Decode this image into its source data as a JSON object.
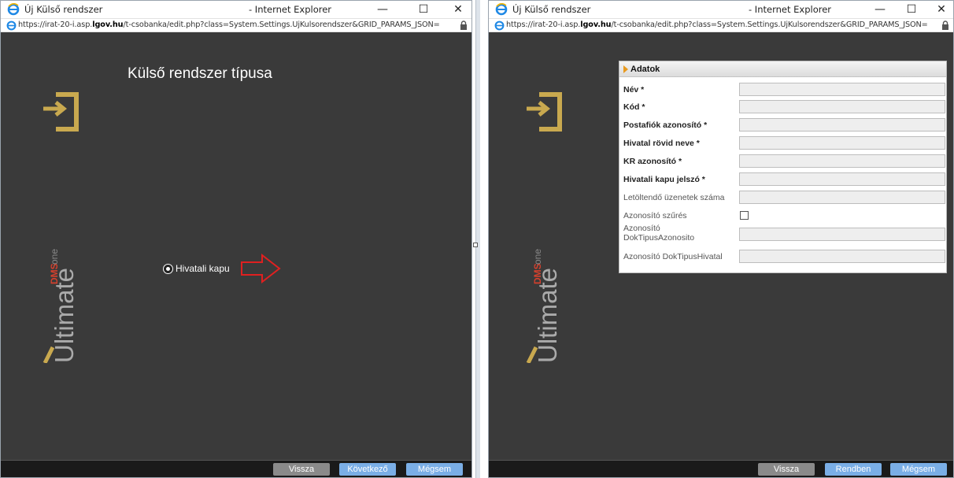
{
  "colors": {
    "accent_gold": "#c9a94f",
    "dark_bg": "#3a3a3a",
    "brand_red": "#d4402d",
    "button_blue": "#7aaee6",
    "button_grey": "#8a8a8a"
  },
  "left_window": {
    "title": "Új Külső rendszer",
    "title_right": "- Internet Explorer",
    "controls": {
      "minimize": "—",
      "maximize": "☐",
      "close": "✕"
    },
    "address": {
      "prefix": "https://irat-20-i.asp.",
      "domain": "lgov.hu",
      "rest": "/t-csobanka/edit.php?class=System.Settings.UjKulsorendszer&GRID_PARAMS_JSON="
    },
    "heading": "Külső rendszer típusa",
    "radio_label": "Hivatali kapu",
    "brand": {
      "top": "DMS",
      "top2": "one",
      "main": "Ultimate"
    },
    "buttons": {
      "back": "Vissza",
      "next": "Következő",
      "cancel": "Mégsem"
    }
  },
  "right_window": {
    "title": "Új Külső rendszer",
    "title_right": "- Internet Explorer",
    "controls": {
      "minimize": "—",
      "maximize": "☐",
      "close": "✕"
    },
    "address": {
      "prefix": "https://irat-20-i.asp.",
      "domain": "lgov.hu",
      "rest": "/t-csobanka/edit.php?class=System.Settings.UjKulsorendszer&GRID_PARAMS_JSON="
    },
    "panel_title": "Adatok",
    "fields": [
      {
        "label": "Név *"
      },
      {
        "label": "Kód *"
      },
      {
        "label": "Postafiók azonosító *"
      },
      {
        "label": "Hivatal rövid neve *"
      },
      {
        "label": "KR azonosító *"
      },
      {
        "label": "Hivatali kapu jelszó *"
      },
      {
        "label": "Letöltendő üzenetek száma"
      },
      {
        "label": "Azonosító szűrés"
      },
      {
        "label": "Azonosító DokTipusAzonosito"
      },
      {
        "label": "Azonosító DokTipusHivatal"
      }
    ],
    "brand": {
      "top": "DMS",
      "top2": "one",
      "main": "Ultimate"
    },
    "buttons": {
      "back": "Vissza",
      "ok": "Rendben",
      "cancel": "Mégsem"
    }
  }
}
